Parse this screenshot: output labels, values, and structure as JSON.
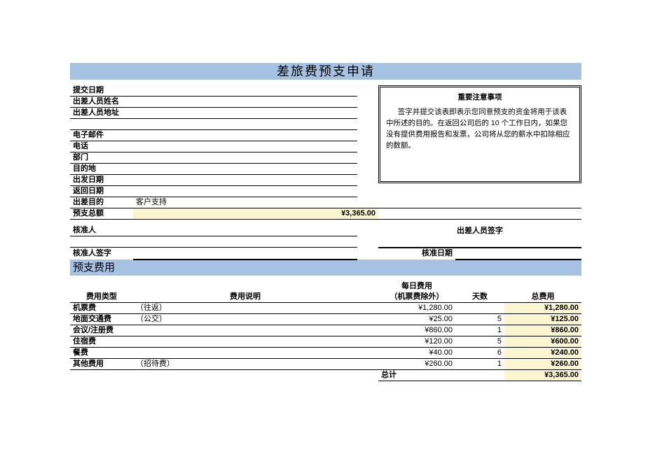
{
  "title": "差旅费预支申请",
  "notice": {
    "heading": "重要注意事项",
    "body": "签字并提交该表即表示您同意预支的资金将用于该表中所述的目的。在返回公司后的 10 个工作日内，如果您没有提供费用报告和发票，公司将从您的薪水中扣除相应的数额。"
  },
  "fields": {
    "submit_date": {
      "label": "提交日期",
      "value": ""
    },
    "traveler_name": {
      "label": "出差人员姓名",
      "value": ""
    },
    "traveler_addr": {
      "label": "出差人员地址",
      "value": ""
    },
    "email": {
      "label": "电子邮件",
      "value": ""
    },
    "phone": {
      "label": "电话",
      "value": ""
    },
    "dept": {
      "label": "部门",
      "value": ""
    },
    "destination": {
      "label": "目的地",
      "value": ""
    },
    "depart_date": {
      "label": "出发日期",
      "value": ""
    },
    "return_date": {
      "label": "返回日期",
      "value": ""
    },
    "purpose": {
      "label": "出差目的",
      "value": "客户支持"
    },
    "advance_total": {
      "label": "预支总额",
      "value": "¥3,365.00"
    }
  },
  "approval": {
    "approver_label": "核准人",
    "traveler_sig_label": "出差人员签字",
    "approver_sig_label": "核准人签字",
    "approve_date_label": "核准日期"
  },
  "expenses_section_title": "预支费用",
  "expense_headers": {
    "type": "费用类型",
    "desc": "费用说明",
    "daily_line1": "每日费用",
    "daily_line2": "（机票费除外）",
    "days": "天数",
    "total": "总费用"
  },
  "expenses": [
    {
      "type": "机票费",
      "desc": "（往返）",
      "daily": "¥1,280.00",
      "days": "",
      "total": "¥1,280.00"
    },
    {
      "type": "地面交通费",
      "desc": "（公交）",
      "daily": "¥25.00",
      "days": "5",
      "total": "¥125.00"
    },
    {
      "type": "会议/注册费",
      "desc": "",
      "daily": "¥860.00",
      "days": "1",
      "total": "¥860.00"
    },
    {
      "type": "住宿费",
      "desc": "",
      "daily": "¥120.00",
      "days": "5",
      "total": "¥600.00"
    },
    {
      "type": "餐费",
      "desc": "",
      "daily": "¥40.00",
      "days": "6",
      "total": "¥240.00"
    },
    {
      "type": "其他费用",
      "desc": "（招待费）",
      "daily": "¥260.00",
      "days": "1",
      "total": "¥260.00"
    }
  ],
  "grand_total": {
    "label": "总计",
    "value": "¥3,365.00"
  },
  "chart_data": {
    "type": "table",
    "title": "预支费用",
    "columns": [
      "费用类型",
      "费用说明",
      "每日费用（机票费除外）",
      "天数",
      "总费用"
    ],
    "rows": [
      [
        "机票费",
        "（往返）",
        1280.0,
        null,
        1280.0
      ],
      [
        "地面交通费",
        "（公交）",
        25.0,
        5,
        125.0
      ],
      [
        "会议/注册费",
        "",
        860.0,
        1,
        860.0
      ],
      [
        "住宿费",
        "",
        120.0,
        5,
        600.0
      ],
      [
        "餐费",
        "",
        40.0,
        6,
        240.0
      ],
      [
        "其他费用",
        "（招待费）",
        260.0,
        1,
        260.0
      ]
    ],
    "total": 3365.0,
    "currency": "¥"
  }
}
